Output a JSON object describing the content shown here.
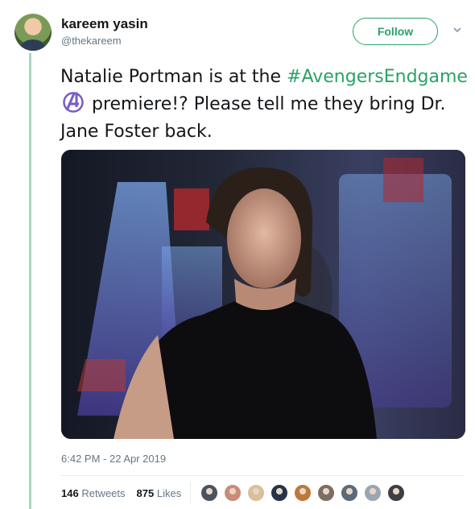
{
  "author": {
    "name": "kareem yasin",
    "handle": "@thekareem"
  },
  "follow_label": "Follow",
  "tweet": {
    "text_before": "Natalie Portman is at the ",
    "hashtag": "#AvengersEndgame",
    "text_after": " premiere!? Please tell me they bring Dr. Jane Foster back.",
    "emoji_icon": "avengers-logo-icon"
  },
  "timestamp": "6:42 PM - 22 Apr 2019",
  "stats": {
    "retweets_count": "146",
    "retweets_label": "Retweets",
    "likes_count": "875",
    "likes_label": "Likes"
  },
  "likers": [
    {
      "icon": "liker-avatar",
      "color": "#4a5260"
    },
    {
      "icon": "liker-avatar",
      "color": "#c98b7a"
    },
    {
      "icon": "liker-avatar",
      "color": "#d8c09a"
    },
    {
      "icon": "liker-avatar",
      "color": "#27324a"
    },
    {
      "icon": "liker-avatar",
      "color": "#b97a3a"
    },
    {
      "icon": "liker-avatar",
      "color": "#7d6e62"
    },
    {
      "icon": "liker-avatar",
      "color": "#5b6a78"
    },
    {
      "icon": "liker-avatar",
      "color": "#9aa6b0"
    },
    {
      "icon": "liker-avatar",
      "color": "#3d3f45"
    }
  ],
  "colors": {
    "accent": "#2aa266",
    "thread_line": "#a8d8bf",
    "text": "#14171a",
    "muted": "#657786"
  }
}
